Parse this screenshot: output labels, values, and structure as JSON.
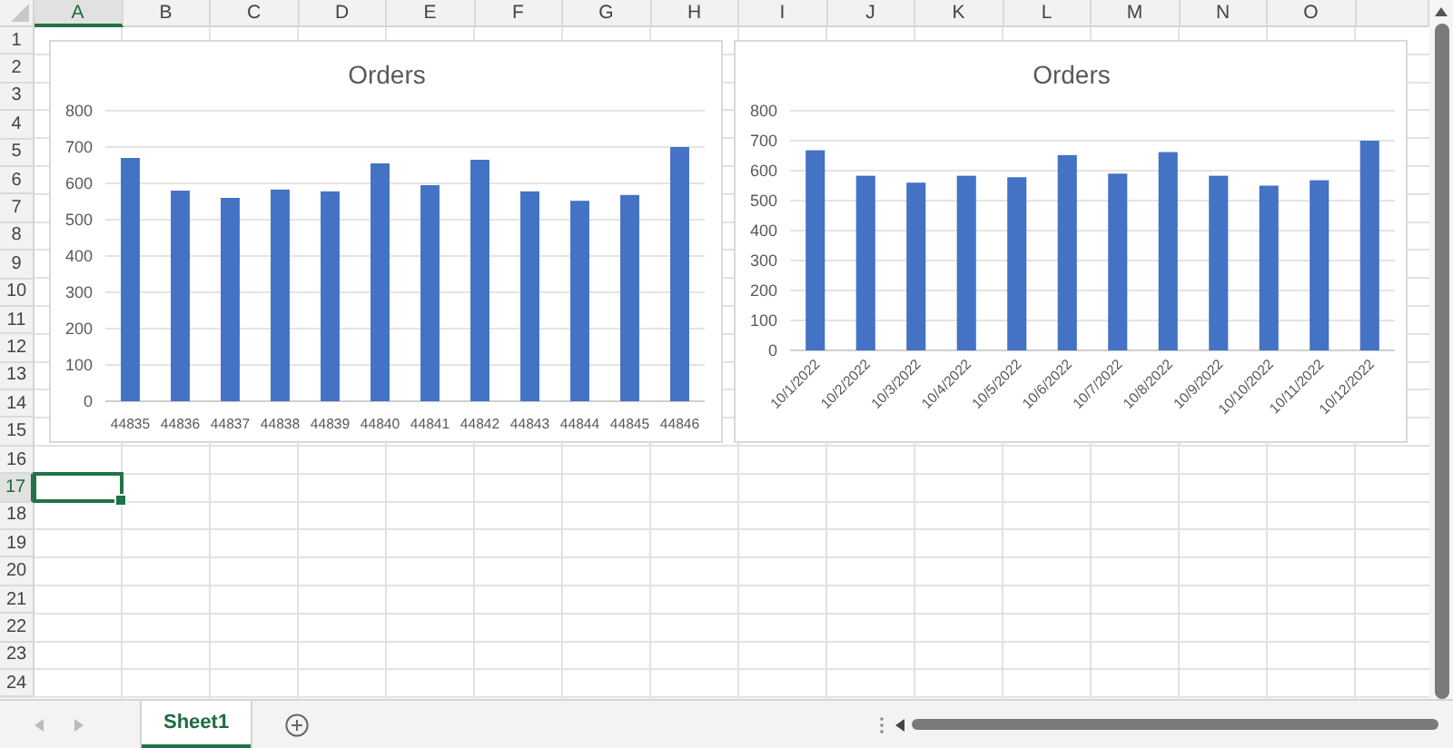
{
  "column_headers": [
    {
      "label": "A",
      "selected": true
    },
    {
      "label": "B",
      "selected": false
    },
    {
      "label": "C",
      "selected": false
    },
    {
      "label": "D",
      "selected": false
    },
    {
      "label": "E",
      "selected": false
    },
    {
      "label": "F",
      "selected": false
    },
    {
      "label": "G",
      "selected": false
    },
    {
      "label": "H",
      "selected": false
    },
    {
      "label": "I",
      "selected": false
    },
    {
      "label": "J",
      "selected": false
    },
    {
      "label": "K",
      "selected": false
    },
    {
      "label": "L",
      "selected": false
    },
    {
      "label": "M",
      "selected": false
    },
    {
      "label": "N",
      "selected": false
    },
    {
      "label": "O",
      "selected": false
    }
  ],
  "row_headers": [
    {
      "label": "1",
      "selected": false
    },
    {
      "label": "2",
      "selected": false
    },
    {
      "label": "3",
      "selected": false
    },
    {
      "label": "4",
      "selected": false
    },
    {
      "label": "5",
      "selected": false
    },
    {
      "label": "6",
      "selected": false
    },
    {
      "label": "7",
      "selected": false
    },
    {
      "label": "8",
      "selected": false
    },
    {
      "label": "9",
      "selected": false
    },
    {
      "label": "10",
      "selected": false
    },
    {
      "label": "11",
      "selected": false
    },
    {
      "label": "12",
      "selected": false
    },
    {
      "label": "13",
      "selected": false
    },
    {
      "label": "14",
      "selected": false
    },
    {
      "label": "15",
      "selected": false
    },
    {
      "label": "16",
      "selected": false
    },
    {
      "label": "17",
      "selected": true
    },
    {
      "label": "18",
      "selected": false
    },
    {
      "label": "19",
      "selected": false
    },
    {
      "label": "20",
      "selected": false
    },
    {
      "label": "21",
      "selected": false
    },
    {
      "label": "22",
      "selected": false
    },
    {
      "label": "23",
      "selected": false
    },
    {
      "label": "24",
      "selected": false
    }
  ],
  "charts": [
    {
      "kind": "straight_labels",
      "chart_data": {
        "type": "bar",
        "grid": true,
        "title": "Orders",
        "categories": [
          "44835",
          "44836",
          "44837",
          "44838",
          "44839",
          "44840",
          "44841",
          "44842",
          "44843",
          "44844",
          "44845",
          "44846"
        ],
        "series": [
          {
            "color": "#4472c4",
            "values": [
              670,
              580,
              560,
              583,
              578,
              655,
              595,
              665,
              578,
              552,
              568,
              700
            ]
          }
        ],
        "ylim": [
          0,
          800
        ],
        "yticks": [
          0,
          100,
          200,
          300,
          400,
          500,
          600,
          700,
          800
        ]
      }
    },
    {
      "kind": "slanted_labels",
      "chart_data": {
        "type": "bar",
        "grid": true,
        "title": "Orders",
        "categories": [
          "10/1/2022",
          "10/2/2022",
          "10/3/2022",
          "10/4/2022",
          "10/5/2022",
          "10/6/2022",
          "10/7/2022",
          "10/8/2022",
          "10/9/2022",
          "10/10/2022",
          "10/11/2022",
          "10/12/2022"
        ],
        "series": [
          {
            "color": "#4472c4",
            "values": [
              668,
              583,
              560,
              583,
              578,
              652,
              590,
              662,
              583,
              550,
              568,
              700
            ]
          }
        ],
        "ylim": [
          0,
          800
        ],
        "yticks": [
          0,
          100,
          200,
          300,
          400,
          500,
          600,
          700,
          800
        ]
      }
    }
  ],
  "sheet_tabs": [
    {
      "label": "Sheet1",
      "selected": true
    }
  ]
}
